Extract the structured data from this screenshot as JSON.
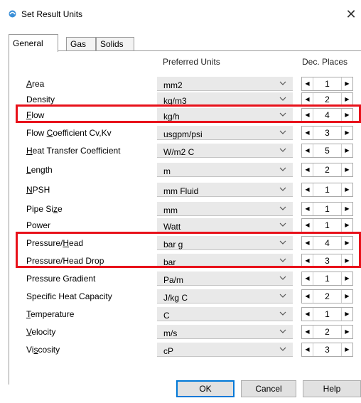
{
  "window": {
    "title": "Set Result Units",
    "close_glyph": "✕"
  },
  "tabs": [
    {
      "label": "General",
      "active": true
    },
    {
      "label": "Gas",
      "active": false
    },
    {
      "label": "Solids",
      "active": false
    }
  ],
  "headers": {
    "units": "Preferred Units",
    "places": "Dec. Places"
  },
  "rows": [
    {
      "label": "Area",
      "ul": "A",
      "rest": "rea",
      "pre": "",
      "unit": "mm2",
      "places": "1"
    },
    {
      "label": "Density",
      "pre": "",
      "ul": "",
      "rest": "Density",
      "unit": "kg/m3",
      "places": "2"
    },
    {
      "label": "Flow",
      "pre": "",
      "ul": "F",
      "rest": "low",
      "unit": "kg/h",
      "places": "4"
    },
    {
      "label": "Flow Coefficient Cv,Kv",
      "pre": "Flow ",
      "ul": "C",
      "rest": "oefficient Cv,Kv",
      "unit": "usgpm/psi",
      "places": "3"
    },
    {
      "label": "Heat Transfer Coefficient",
      "pre": "",
      "ul": "H",
      "rest": "eat Transfer Coefficient",
      "unit": "W/m2 C",
      "places": "5"
    },
    {
      "label": "Length",
      "pre": "",
      "ul": "L",
      "rest": "ength",
      "unit": "m",
      "places": "2"
    },
    {
      "label": "NPSH",
      "pre": "",
      "ul": "N",
      "rest": "PSH",
      "unit": "mm Fluid",
      "places": "1"
    },
    {
      "label": "Pipe Size",
      "pre": "Pipe Si",
      "ul": "z",
      "rest": "e",
      "unit": "mm",
      "places": "1"
    },
    {
      "label": "Power",
      "pre": "",
      "ul": "",
      "rest": "Power",
      "unit": "Watt",
      "places": "1"
    },
    {
      "label": "Pressure/Head",
      "pre": "Pressure/",
      "ul": "H",
      "rest": "ead",
      "unit": "bar g",
      "places": "4"
    },
    {
      "label": "Pressure/Head Drop",
      "pre": "",
      "ul": "",
      "rest": "Pressure/Head Drop",
      "unit": "bar",
      "places": "3"
    },
    {
      "label": "Pressure Gradient",
      "pre": "",
      "ul": "",
      "rest": "Pressure Gradient",
      "unit": "Pa/m",
      "places": "1"
    },
    {
      "label": "Specific Heat Capacity",
      "pre": "",
      "ul": "",
      "rest": "Specific Heat Capacity",
      "unit": "J/kg C",
      "places": "2"
    },
    {
      "label": "Temperature",
      "pre": "",
      "ul": "T",
      "rest": "emperature",
      "unit": "C",
      "places": "1"
    },
    {
      "label": "Velocity",
      "pre": "",
      "ul": "V",
      "rest": "elocity",
      "unit": "m/s",
      "places": "2"
    },
    {
      "label": "Viscosity",
      "pre": "Vi",
      "ul": "s",
      "rest": "cosity",
      "unit": "cP",
      "places": "3"
    }
  ],
  "buttons": {
    "ok": "OK",
    "cancel": "Cancel",
    "help": "Help"
  },
  "highlight_color": "#e8111a",
  "icons": {
    "title": "app-icon",
    "dropdown": "chevron-down-icon",
    "spin_left": "left-arrow-icon",
    "spin_right": "right-arrow-icon"
  }
}
